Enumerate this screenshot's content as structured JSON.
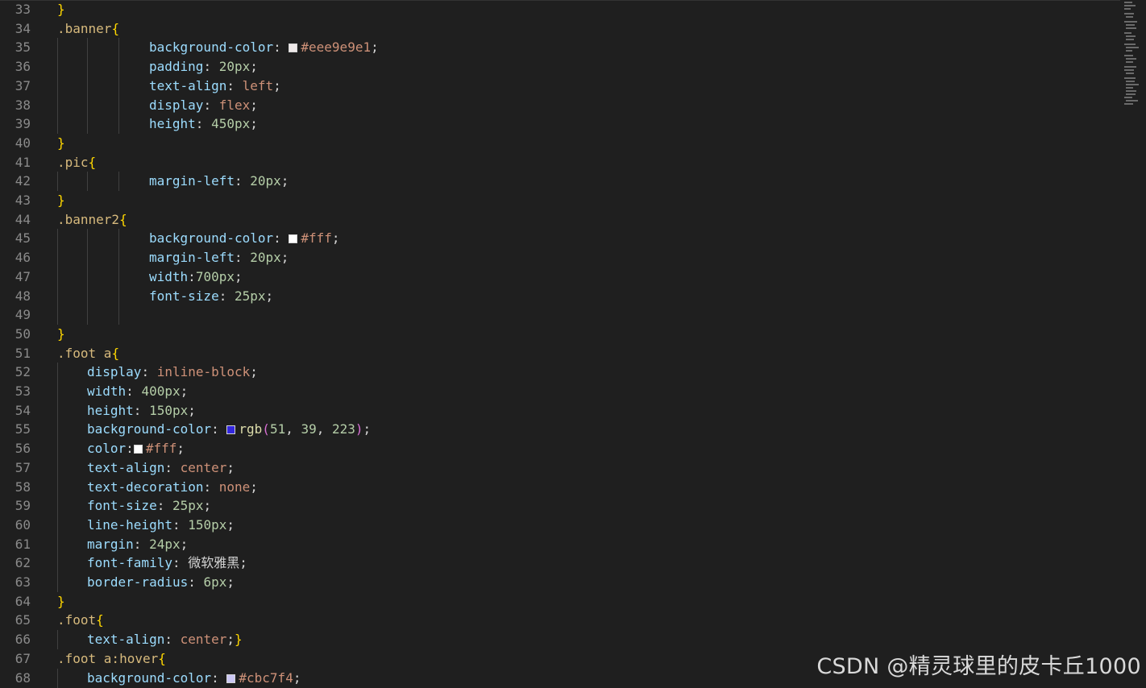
{
  "editor": {
    "lines": [
      {
        "n": "33",
        "tokens": [
          {
            "t": "}",
            "c": "brace"
          }
        ]
      },
      {
        "n": "34",
        "tokens": [
          {
            "t": ".banner",
            "c": "sel"
          },
          {
            "t": "{",
            "c": "brace"
          }
        ]
      },
      {
        "n": "35",
        "indent": 3,
        "tokens": [
          {
            "t": "background-color",
            "c": "prop"
          },
          {
            "t": ": ",
            "c": "punc"
          },
          {
            "swatch": "#eee9e9"
          },
          {
            "t": "#eee9e9e1",
            "c": "val"
          },
          {
            "t": ";",
            "c": "punc"
          }
        ]
      },
      {
        "n": "36",
        "indent": 3,
        "tokens": [
          {
            "t": "padding",
            "c": "prop"
          },
          {
            "t": ": ",
            "c": "punc"
          },
          {
            "t": "20px",
            "c": "num"
          },
          {
            "t": ";",
            "c": "punc"
          }
        ]
      },
      {
        "n": "37",
        "indent": 3,
        "tokens": [
          {
            "t": "text-align",
            "c": "prop"
          },
          {
            "t": ": ",
            "c": "punc"
          },
          {
            "t": "left",
            "c": "val"
          },
          {
            "t": ";",
            "c": "punc"
          }
        ]
      },
      {
        "n": "38",
        "indent": 3,
        "tokens": [
          {
            "t": "display",
            "c": "prop"
          },
          {
            "t": ": ",
            "c": "punc"
          },
          {
            "t": "flex",
            "c": "val"
          },
          {
            "t": ";",
            "c": "punc"
          }
        ]
      },
      {
        "n": "39",
        "indent": 3,
        "tokens": [
          {
            "t": "height",
            "c": "prop"
          },
          {
            "t": ": ",
            "c": "punc"
          },
          {
            "t": "450px",
            "c": "num"
          },
          {
            "t": ";",
            "c": "punc"
          }
        ]
      },
      {
        "n": "40",
        "tokens": [
          {
            "t": "}",
            "c": "brace"
          }
        ]
      },
      {
        "n": "41",
        "tokens": [
          {
            "t": ".pic",
            "c": "sel"
          },
          {
            "t": "{",
            "c": "brace"
          }
        ]
      },
      {
        "n": "42",
        "indent": 3,
        "tokens": [
          {
            "t": "margin-left",
            "c": "prop"
          },
          {
            "t": ": ",
            "c": "punc"
          },
          {
            "t": "20px",
            "c": "num"
          },
          {
            "t": ";",
            "c": "punc"
          }
        ]
      },
      {
        "n": "43",
        "tokens": [
          {
            "t": "}",
            "c": "brace"
          }
        ]
      },
      {
        "n": "44",
        "tokens": [
          {
            "t": ".banner2",
            "c": "sel"
          },
          {
            "t": "{",
            "c": "brace"
          }
        ]
      },
      {
        "n": "45",
        "indent": 3,
        "tokens": [
          {
            "t": "background-color",
            "c": "prop"
          },
          {
            "t": ": ",
            "c": "punc"
          },
          {
            "swatch": "#ffffff"
          },
          {
            "t": "#fff",
            "c": "val"
          },
          {
            "t": ";",
            "c": "punc"
          }
        ]
      },
      {
        "n": "46",
        "indent": 3,
        "tokens": [
          {
            "t": "margin-left",
            "c": "prop"
          },
          {
            "t": ": ",
            "c": "punc"
          },
          {
            "t": "20px",
            "c": "num"
          },
          {
            "t": ";",
            "c": "punc"
          }
        ]
      },
      {
        "n": "47",
        "indent": 3,
        "tokens": [
          {
            "t": "width",
            "c": "prop"
          },
          {
            "t": ":",
            "c": "punc"
          },
          {
            "t": "700px",
            "c": "num"
          },
          {
            "t": ";",
            "c": "punc"
          }
        ]
      },
      {
        "n": "48",
        "indent": 3,
        "tokens": [
          {
            "t": "font-size",
            "c": "prop"
          },
          {
            "t": ": ",
            "c": "punc"
          },
          {
            "t": "25px",
            "c": "num"
          },
          {
            "t": ";",
            "c": "punc"
          }
        ]
      },
      {
        "n": "49",
        "tokens": []
      },
      {
        "n": "50",
        "tokens": [
          {
            "t": "}",
            "c": "brace"
          }
        ]
      },
      {
        "n": "51",
        "tokens": [
          {
            "t": ".foot a",
            "c": "sel"
          },
          {
            "t": "{",
            "c": "brace"
          }
        ]
      },
      {
        "n": "52",
        "indent": 1,
        "tokens": [
          {
            "t": "display",
            "c": "prop"
          },
          {
            "t": ": ",
            "c": "punc"
          },
          {
            "t": "inline-block",
            "c": "val"
          },
          {
            "t": ";",
            "c": "punc"
          }
        ]
      },
      {
        "n": "53",
        "indent": 1,
        "tokens": [
          {
            "t": "width",
            "c": "prop"
          },
          {
            "t": ": ",
            "c": "punc"
          },
          {
            "t": "400px",
            "c": "num"
          },
          {
            "t": ";",
            "c": "punc"
          }
        ]
      },
      {
        "n": "54",
        "indent": 1,
        "tokens": [
          {
            "t": "height",
            "c": "prop"
          },
          {
            "t": ": ",
            "c": "punc"
          },
          {
            "t": "150px",
            "c": "num"
          },
          {
            "t": ";",
            "c": "punc"
          }
        ]
      },
      {
        "n": "55",
        "indent": 1,
        "tokens": [
          {
            "t": "background-color",
            "c": "prop"
          },
          {
            "t": ": ",
            "c": "punc"
          },
          {
            "swatch": "#3327df"
          },
          {
            "t": "rgb",
            "c": "func"
          },
          {
            "t": "(",
            "c": "paren"
          },
          {
            "t": "51",
            "c": "num"
          },
          {
            "t": ", ",
            "c": "punc"
          },
          {
            "t": "39",
            "c": "num"
          },
          {
            "t": ", ",
            "c": "punc"
          },
          {
            "t": "223",
            "c": "num"
          },
          {
            "t": ")",
            "c": "paren"
          },
          {
            "t": ";",
            "c": "punc"
          }
        ]
      },
      {
        "n": "56",
        "indent": 1,
        "tokens": [
          {
            "t": "color",
            "c": "prop"
          },
          {
            "t": ":",
            "c": "punc"
          },
          {
            "swatch": "#ffffff"
          },
          {
            "t": "#fff",
            "c": "val"
          },
          {
            "t": ";",
            "c": "punc"
          }
        ]
      },
      {
        "n": "57",
        "indent": 1,
        "tokens": [
          {
            "t": "text-align",
            "c": "prop"
          },
          {
            "t": ": ",
            "c": "punc"
          },
          {
            "t": "center",
            "c": "val"
          },
          {
            "t": ";",
            "c": "punc"
          }
        ]
      },
      {
        "n": "58",
        "indent": 1,
        "tokens": [
          {
            "t": "text-decoration",
            "c": "prop"
          },
          {
            "t": ": ",
            "c": "punc"
          },
          {
            "t": "none",
            "c": "val"
          },
          {
            "t": ";",
            "c": "punc"
          }
        ]
      },
      {
        "n": "59",
        "indent": 1,
        "tokens": [
          {
            "t": "font-size",
            "c": "prop"
          },
          {
            "t": ": ",
            "c": "punc"
          },
          {
            "t": "25px",
            "c": "num"
          },
          {
            "t": ";",
            "c": "punc"
          }
        ]
      },
      {
        "n": "60",
        "indent": 1,
        "tokens": [
          {
            "t": "line-height",
            "c": "prop"
          },
          {
            "t": ": ",
            "c": "punc"
          },
          {
            "t": "150px",
            "c": "num"
          },
          {
            "t": ";",
            "c": "punc"
          }
        ]
      },
      {
        "n": "61",
        "indent": 1,
        "tokens": [
          {
            "t": "margin",
            "c": "prop"
          },
          {
            "t": ": ",
            "c": "punc"
          },
          {
            "t": "24px",
            "c": "num"
          },
          {
            "t": ";",
            "c": "punc"
          }
        ]
      },
      {
        "n": "62",
        "indent": 1,
        "tokens": [
          {
            "t": "font-family",
            "c": "prop"
          },
          {
            "t": ": ",
            "c": "punc"
          },
          {
            "t": "微软雅黑",
            "c": "punc"
          },
          {
            "t": ";",
            "c": "punc"
          }
        ]
      },
      {
        "n": "63",
        "indent": 1,
        "tokens": [
          {
            "t": "border-radius",
            "c": "prop"
          },
          {
            "t": ": ",
            "c": "punc"
          },
          {
            "t": "6px",
            "c": "num"
          },
          {
            "t": ";",
            "c": "punc"
          }
        ]
      },
      {
        "n": "64",
        "tokens": [
          {
            "t": "}",
            "c": "brace"
          }
        ]
      },
      {
        "n": "65",
        "tokens": [
          {
            "t": ".foot",
            "c": "sel"
          },
          {
            "t": "{",
            "c": "brace"
          }
        ]
      },
      {
        "n": "66",
        "indent": 1,
        "tokens": [
          {
            "t": "text-align",
            "c": "prop"
          },
          {
            "t": ": ",
            "c": "punc"
          },
          {
            "t": "center",
            "c": "val"
          },
          {
            "t": ";",
            "c": "punc"
          },
          {
            "t": "}",
            "c": "brace"
          }
        ]
      },
      {
        "n": "67",
        "tokens": [
          {
            "t": ".foot a:hover",
            "c": "sel"
          },
          {
            "t": "{",
            "c": "brace"
          }
        ]
      },
      {
        "n": "68",
        "indent": 1,
        "tokens": [
          {
            "t": "background-color",
            "c": "prop"
          },
          {
            "t": ": ",
            "c": "punc"
          },
          {
            "swatch": "#cbc7f4"
          },
          {
            "t": "#cbc7f4",
            "c": "val"
          },
          {
            "t": ";",
            "c": "punc"
          }
        ]
      }
    ]
  },
  "watermark": {
    "text": "CSDN @精灵球里的皮卡丘1000"
  }
}
